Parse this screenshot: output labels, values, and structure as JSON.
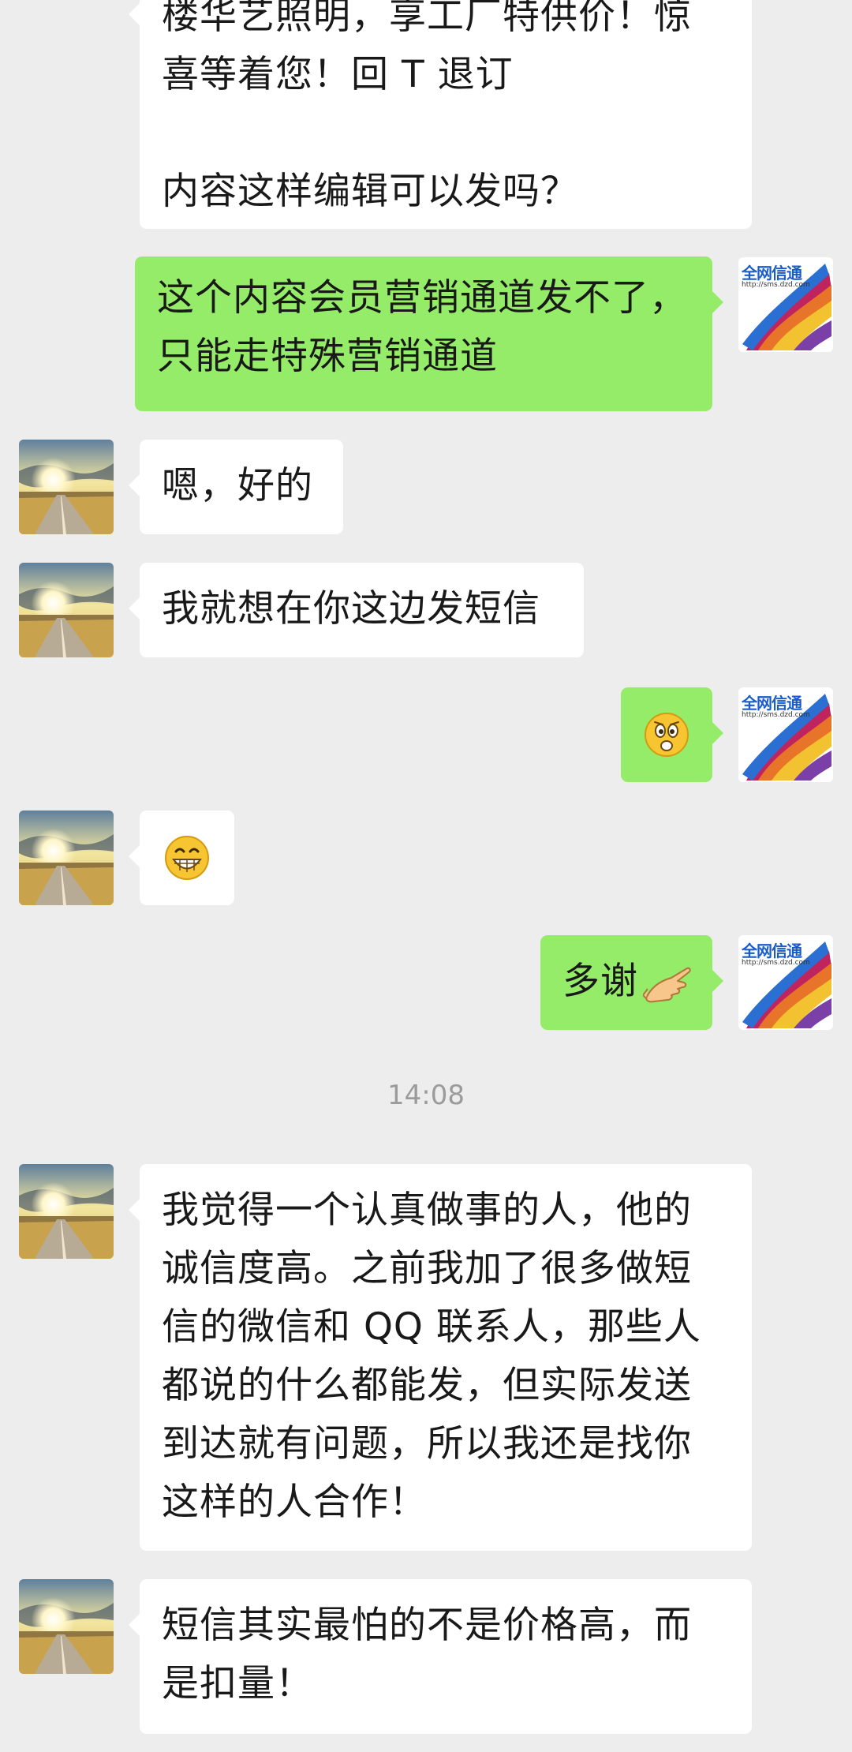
{
  "messages": [
    {
      "side": "left",
      "sender": "contact",
      "lines": [
        "楼华艺照明，享工厂特供价！惊",
        "喜等着您！回 T 退订",
        "",
        "内容这样编辑可以发吗？"
      ]
    },
    {
      "side": "right",
      "sender": "self",
      "lines": [
        "这个内容会员营销通道发不了，",
        "只能走特殊营销通道"
      ]
    },
    {
      "side": "left",
      "sender": "contact",
      "lines": [
        "嗯，好的"
      ]
    },
    {
      "side": "left",
      "sender": "contact",
      "lines": [
        "我就想在你这边发短信"
      ]
    },
    {
      "side": "right",
      "sender": "self",
      "emoji": "surprised-face-emoji"
    },
    {
      "side": "left",
      "sender": "contact",
      "emoji": "grinning-face-emoji"
    },
    {
      "side": "right",
      "sender": "self",
      "lines": [
        "多谢"
      ],
      "trailing_emoji": "pointing-hand-emoji"
    },
    {
      "side": "left",
      "sender": "contact",
      "lines": [
        "我觉得一个认真做事的人，他的",
        "诚信度高。之前我加了很多做短",
        "信的微信和 QQ 联系人，那些人",
        "都说的什么都能发，但实际发送",
        "到达就有问题，所以我还是找你",
        "这样的人合作！"
      ]
    },
    {
      "side": "left",
      "sender": "contact",
      "lines": [
        "短信其实最怕的不是价格高，而",
        "是扣量！"
      ]
    }
  ],
  "timestamp": "14:08",
  "self_avatar": {
    "logo_text": "全网信通",
    "url_text": "http://sms.dzd.com"
  },
  "colors": {
    "background": "#ededed",
    "bubble_right": "#95ec69",
    "bubble_left": "#ffffff",
    "timestamp": "#9b9b9b"
  }
}
